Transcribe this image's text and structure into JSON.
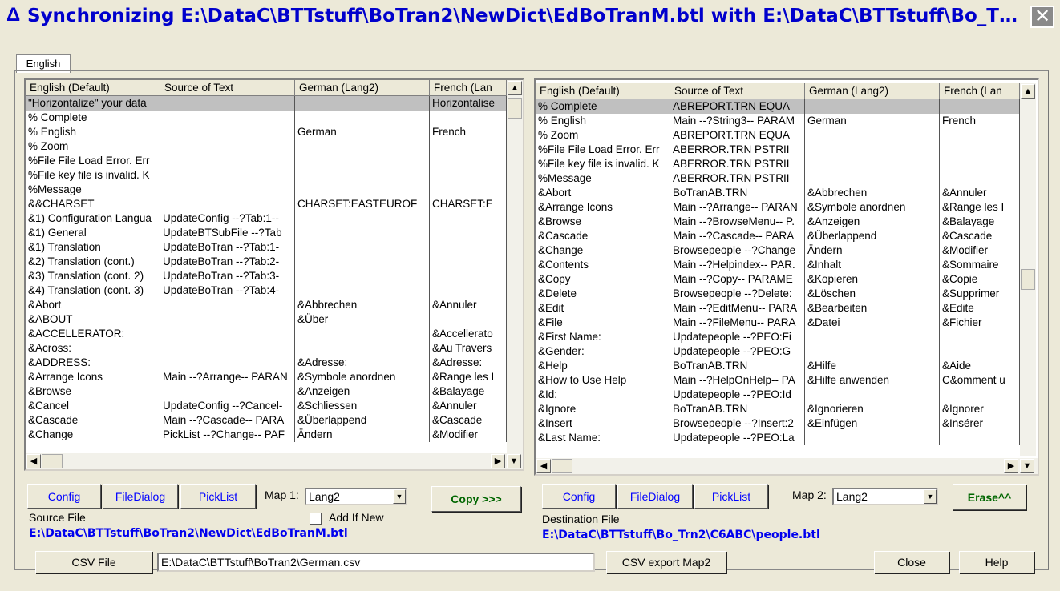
{
  "window": {
    "title": "Synchronizing E:\\DataC\\BTTstuff\\BoTran2\\NewDict\\EdBoTranM.btl with E:\\DataC\\BTTstuff\\Bo_T…",
    "title_icon": "delta-icon",
    "close_icon": "close-icon"
  },
  "tab": {
    "label": "English"
  },
  "left_grid": {
    "columns": [
      "English (Default)",
      "Source of Text",
      "German (Lang2)",
      "French (Lan"
    ],
    "rows": [
      [
        "\"Horizontalize\" your data",
        "",
        "",
        "Horizontalise"
      ],
      [
        "% Complete",
        "",
        "",
        ""
      ],
      [
        "% English",
        "",
        "German",
        "French"
      ],
      [
        "% Zoom",
        "",
        "",
        ""
      ],
      [
        "%File File Load Error.  Err",
        "",
        "",
        ""
      ],
      [
        "%File key file is invalid. K",
        "",
        "",
        ""
      ],
      [
        "%Message",
        "",
        "",
        ""
      ],
      [
        "&&CHARSET",
        "",
        "CHARSET:EASTEUROF",
        "CHARSET:E"
      ],
      [
        "&1) Configuration Langua",
        "UpdateConfig --?Tab:1--",
        "",
        ""
      ],
      [
        "&1) General",
        "UpdateBTSubFile --?Tab",
        "",
        ""
      ],
      [
        "&1) Translation",
        "UpdateBoTran --?Tab:1-",
        "",
        ""
      ],
      [
        "&2) Translation (cont.)",
        "UpdateBoTran --?Tab:2-",
        "",
        ""
      ],
      [
        "&3) Translation (cont. 2)",
        "UpdateBoTran --?Tab:3-",
        "",
        ""
      ],
      [
        "&4) Translation (cont. 3)",
        "UpdateBoTran --?Tab:4-",
        "",
        ""
      ],
      [
        "&Abort",
        "",
        "&Abbrechen",
        "&Annuler"
      ],
      [
        "&ABOUT",
        "",
        "&Über",
        ""
      ],
      [
        "&ACCELLERATOR:",
        "",
        "",
        "&Accellerato"
      ],
      [
        "&Across:",
        "",
        "",
        "&Au Travers"
      ],
      [
        "&ADDRESS:",
        "",
        "&Adresse:",
        "&Adresse:"
      ],
      [
        "&Arrange Icons",
        "Main --?Arrange-- PARAN",
        "&Symbole anordnen",
        "&Range les I"
      ],
      [
        "&Browse",
        "",
        "&Anzeigen",
        "&Balayage"
      ],
      [
        "&Cancel",
        "UpdateConfig --?Cancel-",
        "&Schliessen",
        "&Annuler"
      ],
      [
        "&Cascade",
        "Main --?Cascade-- PARA",
        "&Überlappend",
        "&Cascade"
      ],
      [
        "&Change",
        "PickList --?Change-- PAF",
        "Ändern",
        "&Modifier"
      ]
    ]
  },
  "right_grid": {
    "columns": [
      "English (Default)",
      "Source of Text",
      "German (Lang2)",
      "French (Lan"
    ],
    "rows": [
      [
        "% Complete",
        "ABREPORT.TRN EQUA",
        "",
        ""
      ],
      [
        "% English",
        "Main --?String3-- PARAM",
        "German",
        "French"
      ],
      [
        "% Zoom",
        "ABREPORT.TRN EQUA",
        "",
        ""
      ],
      [
        "%File File Load Error.  Err",
        "ABERROR.TRN PSTRII",
        "",
        ""
      ],
      [
        "%File key file is invalid. K",
        "ABERROR.TRN PSTRII",
        "",
        ""
      ],
      [
        "%Message",
        "ABERROR.TRN PSTRII",
        "",
        ""
      ],
      [
        "&Abort",
        "BoTranAB.TRN",
        "&Abbrechen",
        "&Annuler"
      ],
      [
        "&Arrange Icons",
        "Main --?Arrange-- PARAN",
        "&Symbole anordnen",
        "&Range les I"
      ],
      [
        "&Browse",
        "Main --?BrowseMenu-- P.",
        "&Anzeigen",
        "&Balayage"
      ],
      [
        "&Cascade",
        "Main --?Cascade-- PARA",
        "&Überlappend",
        "&Cascade"
      ],
      [
        "&Change",
        "Browsepeople --?Change",
        "Ändern",
        "&Modifier"
      ],
      [
        "&Contents",
        "Main --?Helpindex-- PAR.",
        "&Inhalt",
        "&Sommaire"
      ],
      [
        "&Copy",
        "Main --?Copy-- PARAME",
        "&Kopieren",
        "&Copie"
      ],
      [
        "&Delete",
        "Browsepeople --?Delete:",
        "&Löschen",
        "&Supprimer"
      ],
      [
        "&Edit",
        "Main --?EditMenu-- PARA",
        "&Bearbeiten",
        "&Edite"
      ],
      [
        "&File",
        "Main --?FileMenu-- PARA",
        "&Datei",
        "&Fichier"
      ],
      [
        "&First Name:",
        "Updatepeople --?PEO:Fi",
        "",
        ""
      ],
      [
        "&Gender:",
        "Updatepeople --?PEO:G",
        "",
        ""
      ],
      [
        "&Help",
        "BoTranAB.TRN",
        "&Hilfe",
        "&Aide"
      ],
      [
        "&How to Use Help",
        "Main --?HelpOnHelp-- PA",
        "&Hilfe anwenden",
        "C&omment u"
      ],
      [
        "&Id:",
        "Updatepeople --?PEO:Id",
        "",
        ""
      ],
      [
        "&Ignore",
        "BoTranAB.TRN",
        "&Ignorieren",
        "&Ignorer"
      ],
      [
        "&Insert",
        "Browsepeople --?Insert:2",
        "&Einfügen",
        "&Insérer"
      ],
      [
        "&Last Name:",
        "Updatepeople --?PEO:La",
        "",
        ""
      ]
    ]
  },
  "left_controls": {
    "config": "Config",
    "filedialog": "FileDialog",
    "picklist": "PickList",
    "map_label": "Map 1:",
    "map_value": "Lang2",
    "copy": "Copy >>>",
    "add_if_new": "Add If New",
    "source_label": "Source File",
    "source_path": "E:\\DataC\\BTTstuff\\BoTran2\\NewDict\\EdBoTranM.btl"
  },
  "right_controls": {
    "config": "Config",
    "filedialog": "FileDialog",
    "picklist": "PickList",
    "map_label": "Map 2:",
    "map_value": "Lang2",
    "erase": "Erase^^",
    "dest_label": "Destination File",
    "dest_path": "E:\\DataC\\BTTstuff\\Bo_Trn2\\C6ABC\\people.btl"
  },
  "bottom": {
    "csv_file": "CSV File",
    "csv_path": "E:\\DataC\\BTTstuff\\BoTran2\\German.csv",
    "csv_export": "CSV export Map2",
    "close": "Close",
    "help": "Help"
  }
}
